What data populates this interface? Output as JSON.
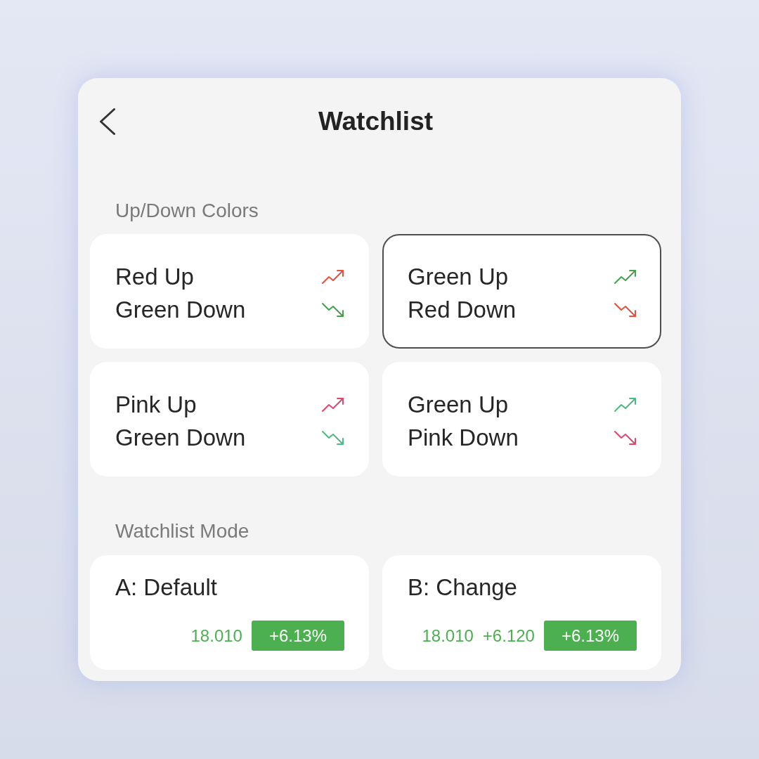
{
  "header": {
    "title": "Watchlist"
  },
  "color_section": {
    "heading": "Up/Down Colors",
    "schemes": [
      {
        "selected": false,
        "lines": [
          {
            "kind": "up",
            "label": "Red Up",
            "color": "#ea4f3d"
          },
          {
            "kind": "down",
            "label": "Green Down",
            "color": "#43a24a"
          }
        ]
      },
      {
        "selected": true,
        "lines": [
          {
            "kind": "up",
            "label": "Green Up",
            "color": "#43a24a"
          },
          {
            "kind": "down",
            "label": "Red Down",
            "color": "#ea4f3d"
          }
        ]
      },
      {
        "selected": false,
        "lines": [
          {
            "kind": "up",
            "label": "Pink Up",
            "color": "#e3456d"
          },
          {
            "kind": "down",
            "label": "Green Down",
            "color": "#4cbb82"
          }
        ]
      },
      {
        "selected": false,
        "lines": [
          {
            "kind": "up",
            "label": "Green Up",
            "color": "#4cbb82"
          },
          {
            "kind": "down",
            "label": "Pink Down",
            "color": "#e3456d"
          }
        ]
      }
    ]
  },
  "mode_section": {
    "heading": "Watchlist Mode",
    "modes": [
      {
        "title": "A: Default",
        "selected": false,
        "values": [
          "18.010"
        ],
        "badge": "+6.13%"
      },
      {
        "title": "B: Change",
        "selected": false,
        "values": [
          "18.010",
          "+6.120"
        ],
        "badge": "+6.13%"
      }
    ]
  }
}
